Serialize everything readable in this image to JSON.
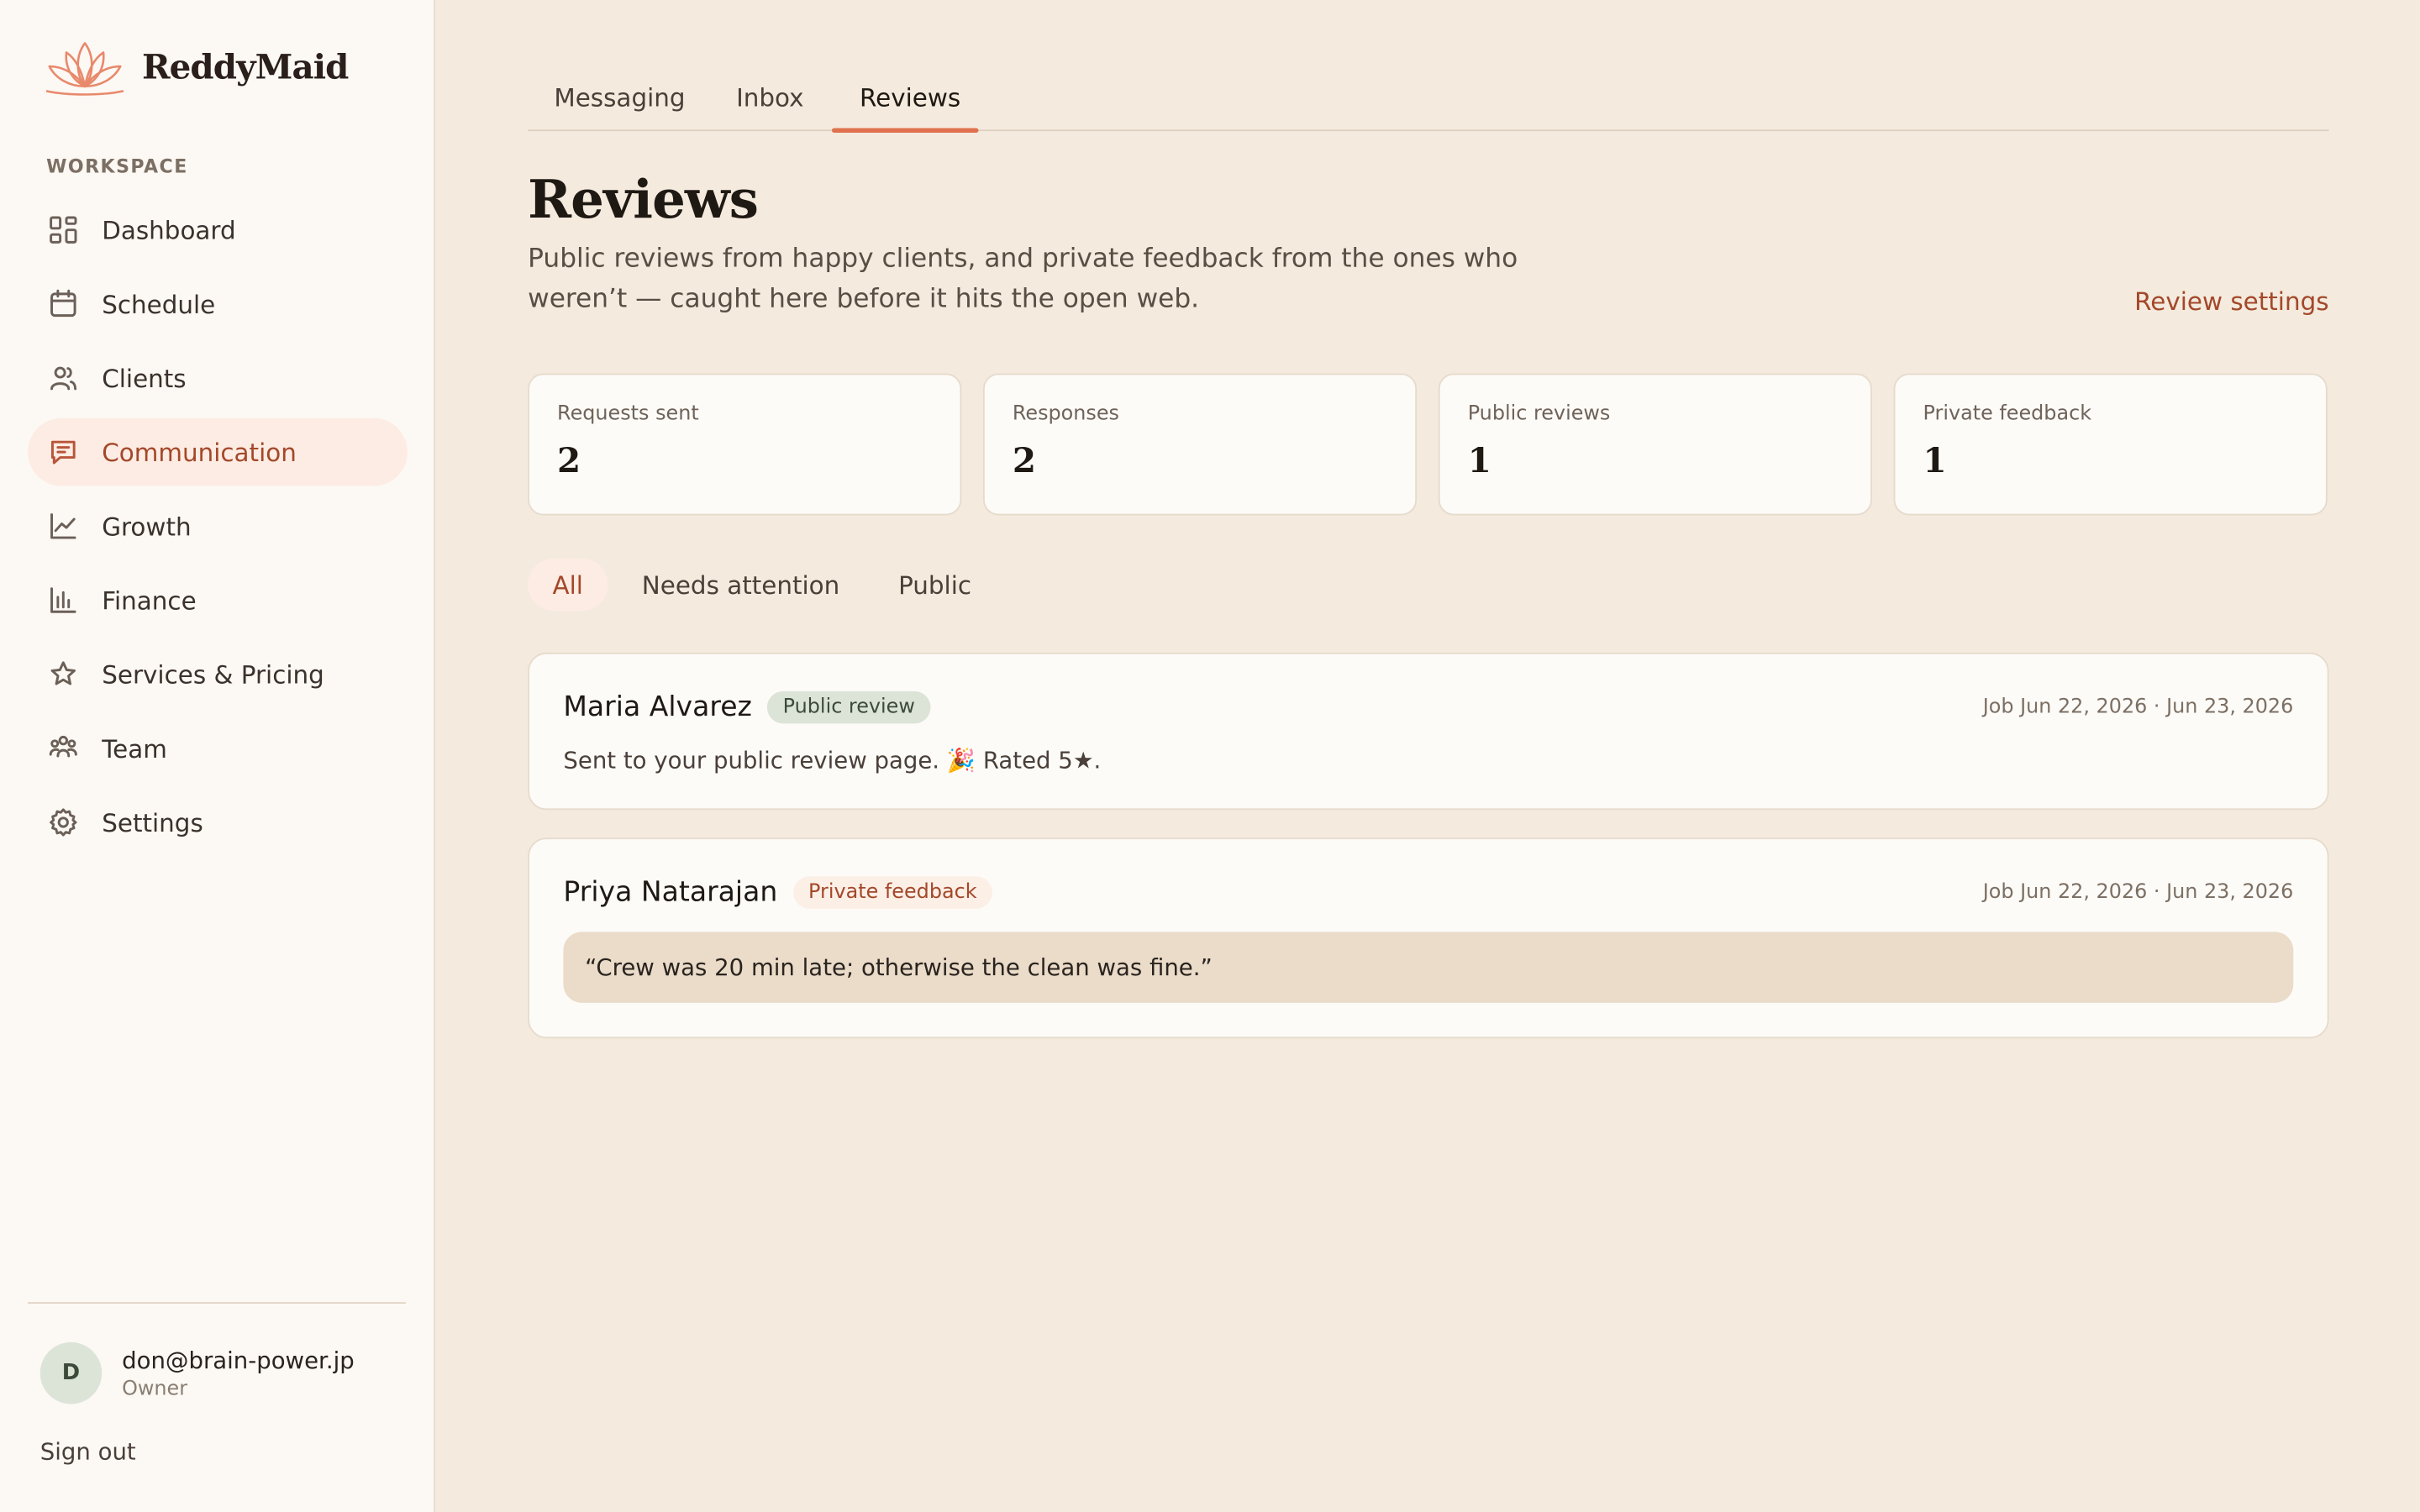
{
  "brand": {
    "name": "ReddyMaid"
  },
  "sidebar": {
    "section_label": "WORKSPACE",
    "items": [
      {
        "label": "Dashboard",
        "icon": "grid-icon"
      },
      {
        "label": "Schedule",
        "icon": "calendar-icon"
      },
      {
        "label": "Clients",
        "icon": "users-icon"
      },
      {
        "label": "Communication",
        "icon": "message-icon",
        "active": true
      },
      {
        "label": "Growth",
        "icon": "trend-icon"
      },
      {
        "label": "Finance",
        "icon": "bar-chart-icon"
      },
      {
        "label": "Services & Pricing",
        "icon": "star-icon"
      },
      {
        "label": "Team",
        "icon": "team-icon"
      },
      {
        "label": "Settings",
        "icon": "gear-icon"
      }
    ],
    "user": {
      "initial": "D",
      "email": "don@brain-power.jp",
      "role": "Owner"
    },
    "sign_out": "Sign out"
  },
  "tabs": [
    {
      "label": "Messaging"
    },
    {
      "label": "Inbox"
    },
    {
      "label": "Reviews",
      "active": true
    }
  ],
  "page": {
    "title": "Reviews",
    "subtitle": "Public reviews from happy clients, and private feedback from the ones who weren’t — caught here before it hits the open web.",
    "settings_link": "Review settings"
  },
  "stats": [
    {
      "label": "Requests sent",
      "value": "2"
    },
    {
      "label": "Responses",
      "value": "2"
    },
    {
      "label": "Public reviews",
      "value": "1"
    },
    {
      "label": "Private feedback",
      "value": "1"
    }
  ],
  "filters": [
    {
      "label": "All",
      "active": true
    },
    {
      "label": "Needs attention"
    },
    {
      "label": "Public"
    }
  ],
  "reviews": [
    {
      "name": "Maria Alvarez",
      "badge": "Public review",
      "date": "Job Jun 22, 2026 · Jun 23, 2026",
      "body": "Sent to your public review page. 🎉 Rated 5★."
    },
    {
      "name": "Priya Natarajan",
      "badge": "Private feedback",
      "date": "Job Jun 22, 2026 · Jun 23, 2026",
      "quote": "“Crew was 20 min late; otherwise the clean was fine.”"
    }
  ],
  "colors": {
    "accent": "#a3482a",
    "tab_underline": "#e0714f",
    "background": "#f4eadd"
  }
}
